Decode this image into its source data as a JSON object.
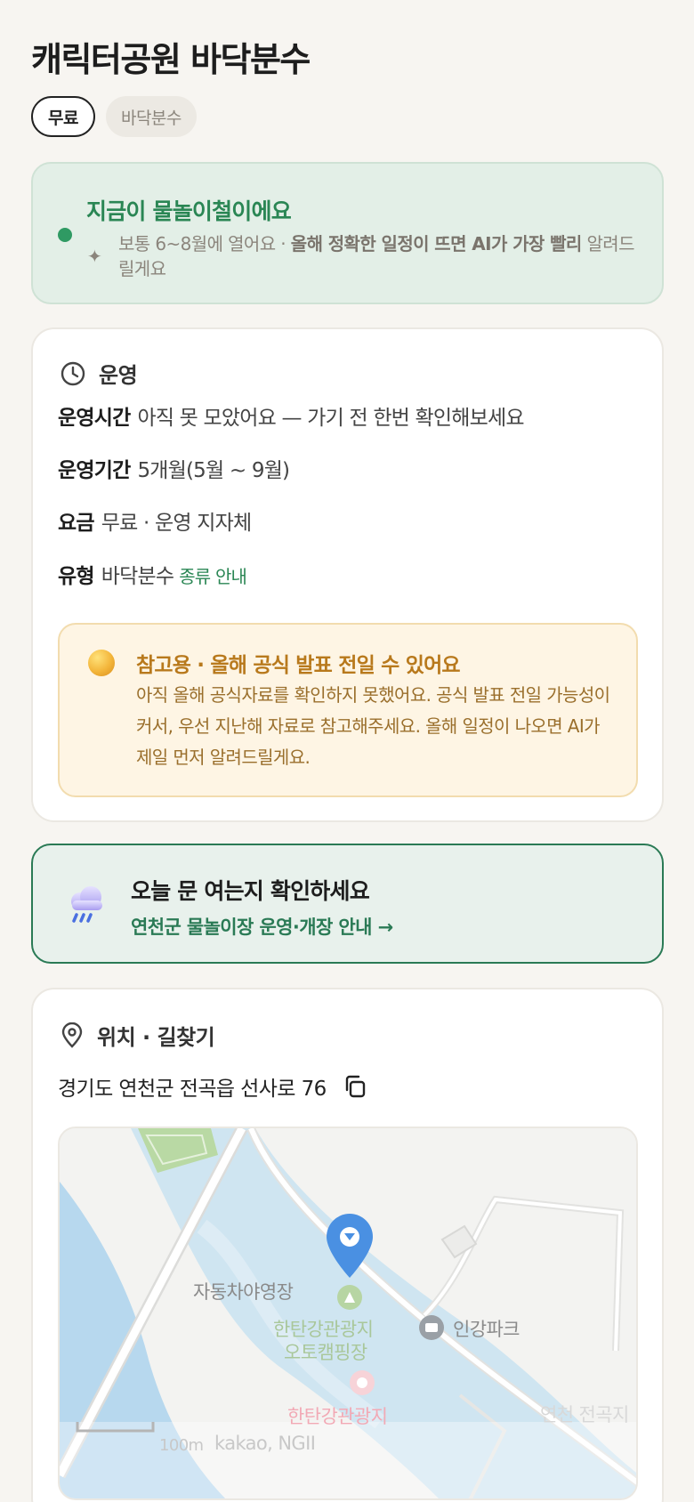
{
  "header": {
    "title": "캐릭터공원 바닥분수",
    "tags": [
      "무료",
      "바닥분수"
    ]
  },
  "season": {
    "title": "지금이 물놀이철이에요",
    "desc_prefix": "보통 6~8월에 열어요 · ",
    "desc_bold": "올해 정확한 일정이 뜨면 AI가 가장 빨리",
    "desc_suffix": "알려드릴게요"
  },
  "operation": {
    "heading": "운영",
    "rows": [
      {
        "label": "운영시간",
        "value": "아직 못 모았어요 — 가기 전 한번 확인해보세요"
      },
      {
        "label": "운영기간",
        "value": "5개월(5월 ~ 9월)"
      },
      {
        "label": "요금",
        "value": "무료 · 운영 지자체"
      },
      {
        "label": "유형",
        "value": "바닥분수",
        "link": "종류 안내"
      }
    ],
    "notice": {
      "title": "참고용 · 올해 공식 발표 전일 수 있어요",
      "body": "아직 올해 공식자료를 확인하지 못했어요. 공식 발표 전일 가능성이 커서, 우선 지난해 자료로 참고해주세요. 올해 일정이 나오면 AI가 제일 먼저 알려드릴게요."
    }
  },
  "status": {
    "title": "오늘 문 여는지 확인하세요",
    "link": "연천군 물놀이장 운영·개장 안내 →"
  },
  "location": {
    "heading": "위치 · 길찾기",
    "address": "경기도 연천군 전곡읍 선사로 76",
    "map": {
      "labels": {
        "camp": "자동차야영장",
        "site_line1": "한탄강관광지",
        "site_line2": "오토캠핑장",
        "park": "인강파크",
        "tourist": "한탄강관광지",
        "town": "연천 전곡지",
        "scale": "100m",
        "credit": "kakao, NGII"
      }
    }
  },
  "colors": {
    "accent_green": "#2a8654",
    "notice_amber": "#b8791c",
    "pin_blue": "#4a90e2"
  }
}
